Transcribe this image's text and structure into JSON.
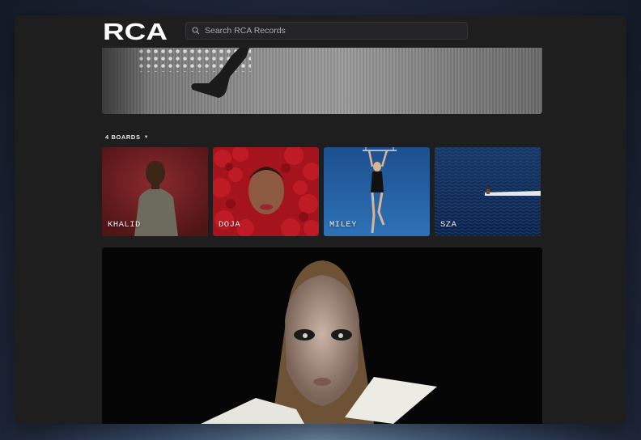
{
  "header": {
    "logo_text": "RCA",
    "search_placeholder": "Search RCA Records"
  },
  "boards_section": {
    "label": "4 BOARDS",
    "boards": [
      {
        "name": "KHALID"
      },
      {
        "name": "DOJA"
      },
      {
        "name": "MILEY"
      },
      {
        "name": "SZA"
      }
    ]
  },
  "colors": {
    "app_bg": "#1e1e1f",
    "search_bg": "#242426",
    "text_primary": "#e8e8ea",
    "khalid_bg": "#7a2226",
    "doja_bg": "#b0121c",
    "miley_bg": "#1f5b9e",
    "sza_bg": "#0f2f63"
  },
  "icons": {
    "search": "search-icon",
    "caret": "chevron-down-icon"
  }
}
